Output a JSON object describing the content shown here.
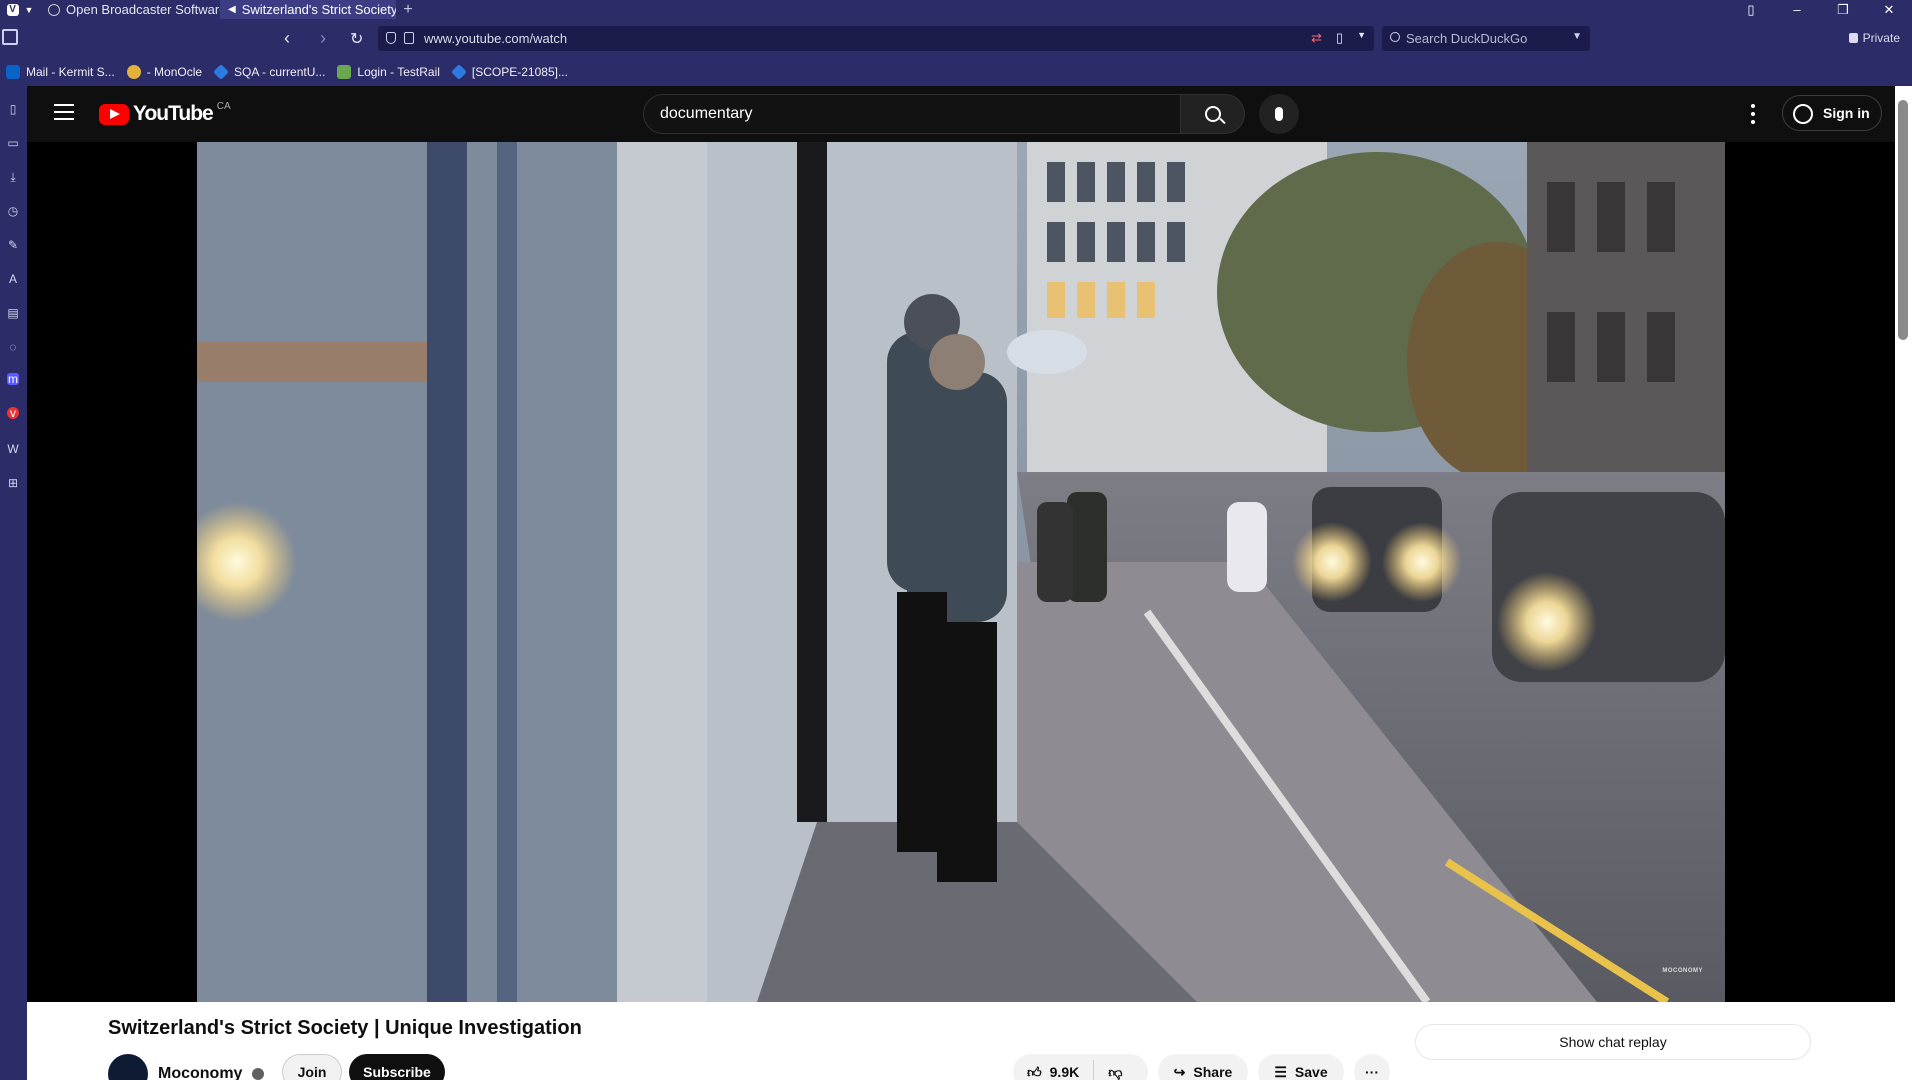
{
  "browser": {
    "tabs": [
      {
        "title": "Open Broadcaster Software"
      },
      {
        "title": "Switzerland's Strict Society |"
      }
    ],
    "new_tab": "+",
    "address": "www.youtube.com/watch",
    "search_placeholder": "Search DuckDuckGo",
    "private_label": "Private",
    "bookmarks": [
      {
        "label": "Mail - Kermit S..."
      },
      {
        "label": "- MonOcle"
      },
      {
        "label": "SQA - currentU..."
      },
      {
        "label": "Login - TestRail"
      },
      {
        "label": "[SCOPE-21085]..."
      }
    ]
  },
  "youtube": {
    "logo_text": "YouTube",
    "country": "CA",
    "search_value": "documentary",
    "sign_in": "Sign in",
    "video": {
      "watermark": "MOCONOMY",
      "title": "Switzerland's Strict Society | Unique Investigation",
      "channel": "Moconomy",
      "join": "Join",
      "subscribe": "Subscribe",
      "likes": "9.9K",
      "share": "Share",
      "save": "Save",
      "more": "···",
      "chat_replay": "Show chat replay"
    }
  },
  "colors": {
    "browser_chrome": "#2b2c68",
    "youtube_red": "#ff0000",
    "page_bg": "#0f0f0f"
  }
}
